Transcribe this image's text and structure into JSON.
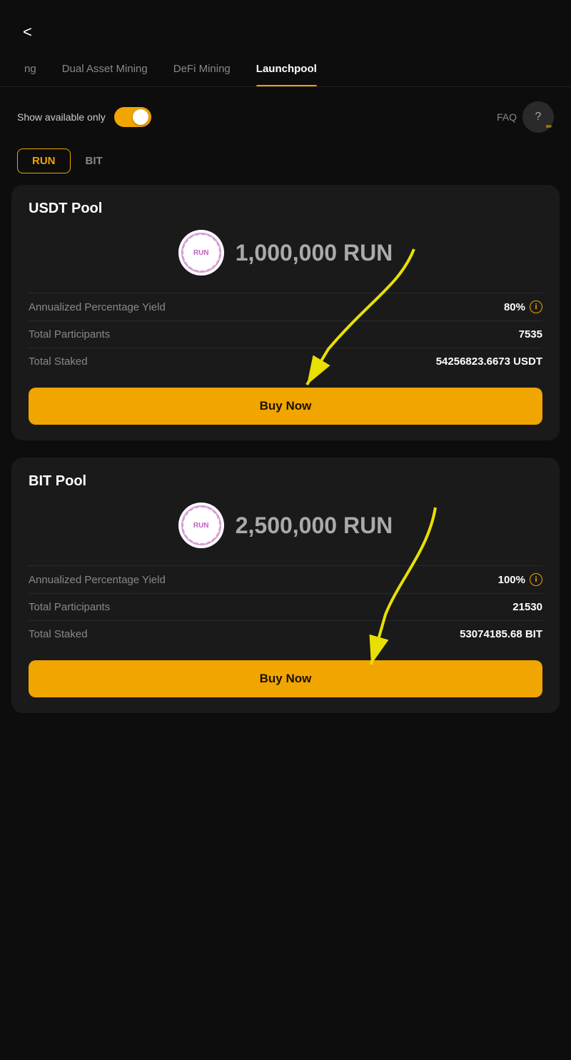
{
  "header": {
    "back_label": "<"
  },
  "tabs": [
    {
      "label": "ng",
      "active": false
    },
    {
      "label": "Dual Asset Mining",
      "active": false
    },
    {
      "label": "DeFi Mining",
      "active": false
    },
    {
      "label": "Launchpool",
      "active": true
    }
  ],
  "controls": {
    "show_available_label": "Show available only",
    "toggle_on": true,
    "faq_label": "FAQ"
  },
  "sub_tabs": [
    {
      "label": "RUN",
      "active": true
    },
    {
      "label": "BIT",
      "active": false
    }
  ],
  "pools": [
    {
      "title": "USDT Pool",
      "token_symbol": "RUN",
      "token_amount": "1,000,000 RUN",
      "apy_label": "Annualized Percentage Yield",
      "apy_value": "80%",
      "participants_label": "Total Participants",
      "participants_value": "7535",
      "staked_label": "Total Staked",
      "staked_value": "54256823.6673 USDT",
      "btn_label": "Buy Now"
    },
    {
      "title": "BIT Pool",
      "token_symbol": "RUN",
      "token_amount": "2,500,000 RUN",
      "apy_label": "Annualized Percentage Yield",
      "apy_value": "100%",
      "participants_label": "Total Participants",
      "participants_value": "21530",
      "staked_label": "Total Staked",
      "staked_value": "53074185.68 BIT",
      "btn_label": "Buy Now"
    }
  ]
}
